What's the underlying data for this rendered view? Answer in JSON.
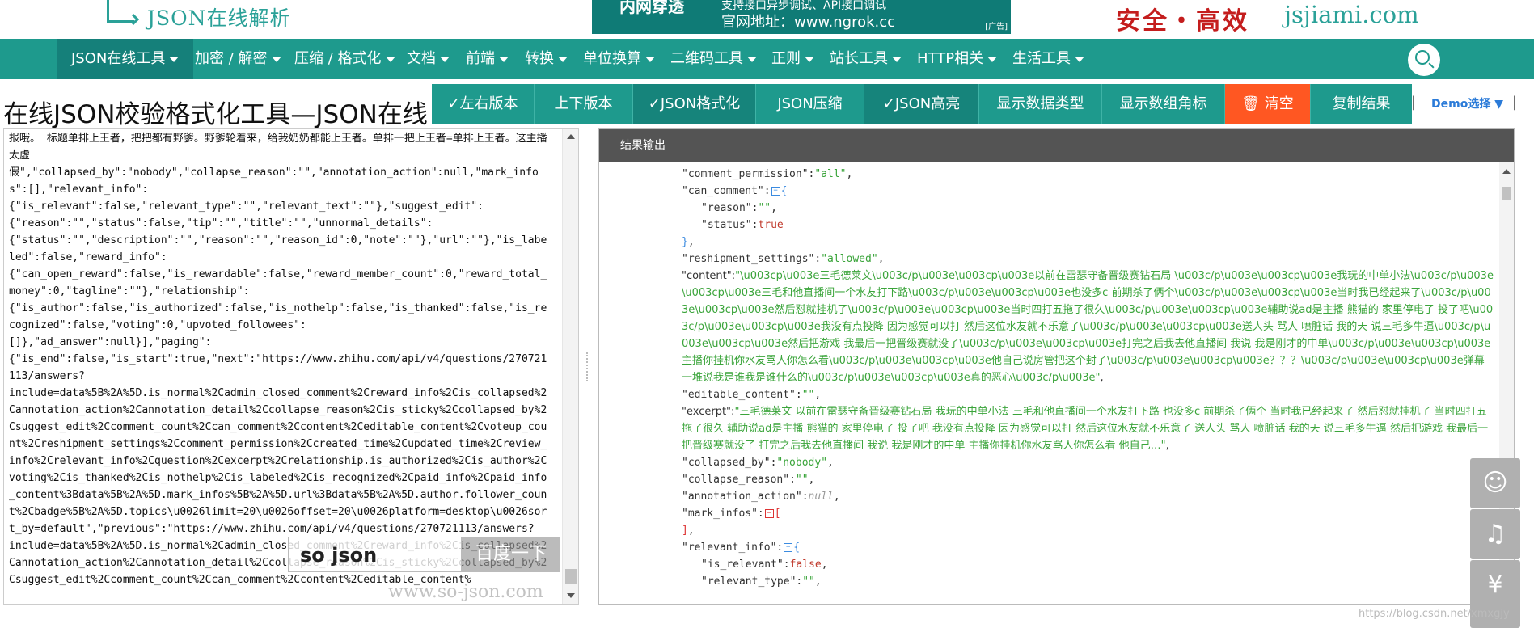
{
  "header": {
    "logo_text": "JSON在线解析",
    "ad": {
      "title": "内网穿透",
      "line1": "支持接口异步调试、API接口调试",
      "line2": "官网地址：www.ngrok.cc",
      "tag": "[广告]"
    },
    "slogan": "安全・高效",
    "domain": "jsjiami.com"
  },
  "nav": {
    "items": [
      {
        "label": "JSON在线工具"
      },
      {
        "label": "加密 / 解密"
      },
      {
        "label": "压缩 / 格式化"
      },
      {
        "label": "文档"
      },
      {
        "label": "前端"
      },
      {
        "label": "转换"
      },
      {
        "label": "单位换算"
      },
      {
        "label": "二维码工具"
      },
      {
        "label": "正则"
      },
      {
        "label": "站长工具"
      },
      {
        "label": "HTTP相关"
      },
      {
        "label": "生活工具"
      }
    ]
  },
  "page_title": "在线JSON校验格式化工具—JSON在线",
  "toolbar": {
    "left_right": "✓左右版本",
    "top_bottom": "上下版本",
    "format": "✓JSON格式化",
    "compress": "JSON压缩",
    "highlight": "✓JSON高亮",
    "show_types": "显示数据类型",
    "show_index": "显示数组角标",
    "clear": "清空",
    "copy": "复制结果",
    "separator": "|",
    "demo": "Demo选择 ▼"
  },
  "input_text": "报哦。 标题单排上王者，把把都有野爹。野爹轮着来，给我奶奶都能上王者。单排一把上王者=单排上王者。这主播太虚\n假\",\"collapsed_by\":\"nobody\",\"collapse_reason\":\"\",\"annotation_action\":null,\"mark_infos\":[],\"relevant_info\":\n{\"is_relevant\":false,\"relevant_type\":\"\",\"relevant_text\":\"\"},\"suggest_edit\":\n{\"reason\":\"\",\"status\":false,\"tip\":\"\",\"title\":\"\",\"unnormal_details\":\n{\"status\":\"\",\"description\":\"\",\"reason\":\"\",\"reason_id\":0,\"note\":\"\"},\"url\":\"\"},\"is_labeled\":false,\"reward_info\":\n{\"can_open_reward\":false,\"is_rewardable\":false,\"reward_member_count\":0,\"reward_total_money\":0,\"tagline\":\"\"},\"relationship\":\n{\"is_author\":false,\"is_authorized\":false,\"is_nothelp\":false,\"is_thanked\":false,\"is_recognized\":false,\"voting\":0,\"upvoted_followees\":\n[]},\"ad_answer\":null}],\"paging\":\n{\"is_end\":false,\"is_start\":true,\"next\":\"https://www.zhihu.com/api/v4/questions/270721113/answers?\ninclude=data%5B%2A%5D.is_normal%2Cadmin_closed_comment%2Creward_info%2Cis_collapsed%2Cannotation_action%2Cannotation_detail%2Ccollapse_reason%2Cis_sticky%2Ccollapsed_by%2Csuggest_edit%2Ccomment_count%2Ccan_comment%2Ccontent%2Ceditable_content%2Cvoteup_count%2Creshipment_settings%2Ccomment_permission%2Ccreated_time%2Cupdated_time%2Creview_info%2Crelevant_info%2Cquestion%2Cexcerpt%2Crelationship.is_authorized%2Cis_author%2Cvoting%2Cis_thanked%2Cis_nothelp%2Cis_labeled%2Cis_recognized%2Cpaid_info%2Cpaid_info_content%3Bdata%5B%2A%5D.mark_infos%5B%2A%5D.url%3Bdata%5B%2A%5D.author.follower_count%2Cbadge%5B%2A%5D.topics\\u0026limit=20\\u0026offset=20\\u0026platform=desktop\\u0026sort_by=default\",\"previous\":\"https://www.zhihu.com/api/v4/questions/270721113/answers?\ninclude=data%5B%2A%5D.is_normal%2Cadmin_closed_comment%2Creward_info%2Cis_collapsed%2Cannotation_action%2Cannotation_detail%2Ccollapse_reason%2Cis_sticky%2Ccollapsed_by%2Csuggest_edit%2Ccomment_count%2Ccan_comment%2Ccontent%2Ceditable_content%",
  "watermark": {
    "so_text": "so json",
    "button": "百度一下",
    "url": "www.so-json.com"
  },
  "result": {
    "header": "结果输出",
    "lines": {
      "comment_permission_key": "\"comment_permission\"",
      "comment_permission_val": "\"all\"",
      "can_comment_key": "\"can_comment\"",
      "reason_key": "\"reason\"",
      "reason_val": "\"\"",
      "status_key": "\"status\"",
      "status_val": "true",
      "reshipment_key": "\"reshipment_settings\"",
      "reshipment_val": "\"allowed\"",
      "content_key": "\"content\"",
      "content_val": "\"\\u003cp\\u003e三毛德莱文\\u003c/p\\u003e\\u003cp\\u003e以前在雷瑟守备晋级赛钻石局 \\u003c/p\\u003e\\u003cp\\u003e我玩的中单小法\\u003c/p\\u003e\\u003cp\\u003e三毛和他直播间一个水友打下路\\u003c/p\\u003e\\u003cp\\u003e也没多c 前期杀了俩个\\u003c/p\\u003e\\u003cp\\u003e当时我已经起来了\\u003c/p\\u003e\\u003cp\\u003e然后怼就挂机了\\u003c/p\\u003e\\u003cp\\u003e当时四打五拖了很久\\u003c/p\\u003e\\u003cp\\u003e辅助说ad是主播 熊猫的 家里停电了 投了吧\\u003c/p\\u003e\\u003cp\\u003e我没有点投降 因为感觉可以打 然后这位水友就不乐意了\\u003c/p\\u003e\\u003cp\\u003e送人头 骂人 喷脏话 我的天 说三毛多牛逼\\u003c/p\\u003e\\u003cp\\u003e然后把游戏 我最后一把晋级赛就没了\\u003c/p\\u003e\\u003cp\\u003e打完之后我去他直播间 我说 我是刚才的中单\\u003c/p\\u003e\\u003cp\\u003e主播你挂机你水友骂人你怎么看\\u003c/p\\u003e\\u003cp\\u003e他自己说房管把这个封了\\u003c/p\\u003e\\u003cp\\u003e？？？\\u003c/p\\u003e\\u003cp\\u003e弹幕一堆说我是谁我是谁什么的\\u003c/p\\u003e\\u003cp\\u003e真的恶心\\u003c/p\\u003e\"",
      "editable_key": "\"editable_content\"",
      "editable_val": "\"\"",
      "excerpt_key": "\"excerpt\"",
      "excerpt_val": "\"三毛德莱文 以前在雷瑟守备晋级赛钻石局 我玩的中单小法 三毛和他直播间一个水友打下路 也没多c 前期杀了俩个 当时我已经起来了 然后怼就挂机了 当时四打五拖了很久 辅助说ad是主播 熊猫的 家里停电了 投了吧 我没有点投降 因为感觉可以打 然后这位水友就不乐意了 送人头 骂人 喷脏话 我的天 说三毛多牛逼 然后把游戏 我最后一把晋级赛就没了 打完之后我去他直播间 我说 我是刚才的中单 主播你挂机你水友骂人你怎么看 他自己…\"",
      "collapsed_by_key": "\"collapsed_by\"",
      "collapsed_by_val": "\"nobody\"",
      "collapse_reason_key": "\"collapse_reason\"",
      "collapse_reason_val": "\"\"",
      "annotation_key": "\"annotation_action\"",
      "annotation_val": "null",
      "mark_infos_key": "\"mark_infos\"",
      "relevant_info_key": "\"relevant_info\"",
      "is_relevant_key": "\"is_relevant\"",
      "is_relevant_val": "false",
      "relevant_type_key": "\"relevant_type\"",
      "relevant_type_val": "\"\""
    }
  },
  "side_tools": {
    "chat_icon": "☺",
    "qq_icon": "♫",
    "yen_icon": "¥"
  },
  "csdn_mark": "https://blog.csdn.net/xmxgjy"
}
